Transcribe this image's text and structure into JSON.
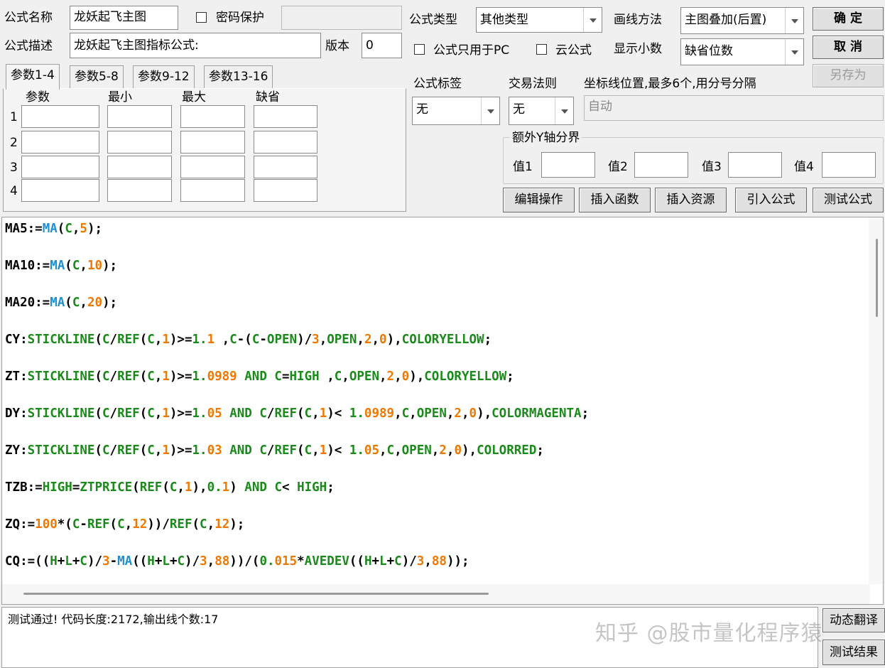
{
  "header": {
    "name_label": "公式名称",
    "name_value": "龙妖起飞主图",
    "password_label": "密码保护",
    "password_value": "",
    "desc_label": "公式描述",
    "desc_value": "龙妖起飞主图指标公式:",
    "version_label": "版本",
    "version_value": "0"
  },
  "tabs": [
    "参数1-4",
    "参数5-8",
    "参数9-12",
    "参数13-16"
  ],
  "params": {
    "headers": [
      "参数",
      "最小",
      "最大",
      "缺省"
    ],
    "rows": [
      "1",
      "2",
      "3",
      "4"
    ]
  },
  "type_label": "公式类型",
  "type_value": "其他类型",
  "draw_label": "画线方法",
  "draw_value": "主图叠加(后置)",
  "pc_only_label": "公式只用于PC",
  "cloud_label": "云公式",
  "decimal_label": "显示小数",
  "decimal_value": "缺省位数",
  "buttons": {
    "ok": "确  定",
    "cancel": "取  消",
    "save_as": "另存为",
    "edit": "编辑操作",
    "insert_func": "插入函数",
    "insert_res": "插入资源",
    "import": "引入公式",
    "test": "测试公式",
    "dynamic_translate": "动态翻译",
    "test_result": "测试结果"
  },
  "tag_label": "公式标签",
  "tag_value": "无",
  "rule_label": "交易法则",
  "rule_value": "无",
  "coord_label": "坐标线位置,最多6个,用分号分隔",
  "coord_placeholder": "自动",
  "yaxis": {
    "title": "额外Y轴分界",
    "labels": [
      "值1",
      "值2",
      "值3",
      "值4"
    ]
  },
  "code_lines": [
    "MA5:=MA(C,5);",
    "MA10:=MA(C,10);",
    "MA20:=MA(C,20);",
    "CY:STICKLINE(C/REF(C,1)>=1.1 ,C-(C-OPEN)/3,OPEN,2,0),COLORYELLOW;",
    "ZT:STICKLINE(C/REF(C,1)>=1.0989 AND C=HIGH ,C,OPEN,2,0),COLORYELLOW;",
    "DY:STICKLINE(C/REF(C,1)>=1.05 AND C/REF(C,1)< 1.0989,C,OPEN,2,0),COLORMAGENTA;",
    "ZY:STICKLINE(C/REF(C,1)>=1.03 AND C/REF(C,1)< 1.05,C,OPEN,2,0),COLORRED;",
    "TZB:=HIGH=ZTPRICE(REF(C,1),0.1) AND C< HIGH;",
    "ZQ:=100*(C-REF(C,12))/REF(C,12);",
    "CQ:=((H+L+C)/3-MA((H+L+C)/3,88))/(0.015*AVEDEV((H+L+C)/3,88));"
  ],
  "result_text": "测试通过! 代码长度:2172,输出线个数:17",
  "watermark": "知乎 @股市量化程序猿"
}
